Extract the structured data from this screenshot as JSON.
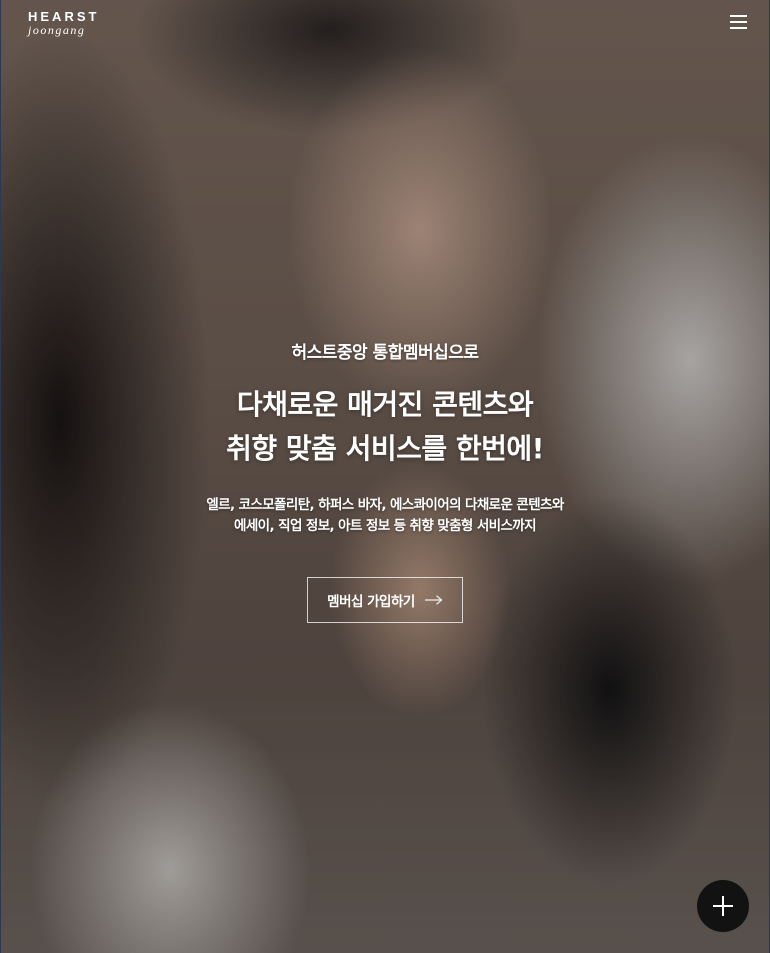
{
  "header": {
    "logo_top": "HEARST",
    "logo_bottom": "joongang",
    "menu_icon": "hamburger-menu-icon"
  },
  "hero": {
    "eyebrow": "허스트중앙 통합멤버십으로",
    "headline_line1": "다채로운 매거진 콘텐츠와",
    "headline_line2": "취향 맞춤 서비스를 한번에!",
    "description_line1": "엘르, 코스모폴리탄, 하퍼스 바자, 에스콰이어의 다채로운 콘텐츠와",
    "description_line2": "에세이, 직업 정보, 아트 정보 등 취향 맞춤형 서비스까지",
    "cta_label": "멤버십 가입하기",
    "cta_icon": "arrow-right-icon"
  },
  "fab": {
    "icon": "plus-icon"
  },
  "colors": {
    "text": "#ffffff",
    "fab_background": "#121212",
    "button_border": "rgba(255,255,255,0.75)"
  }
}
